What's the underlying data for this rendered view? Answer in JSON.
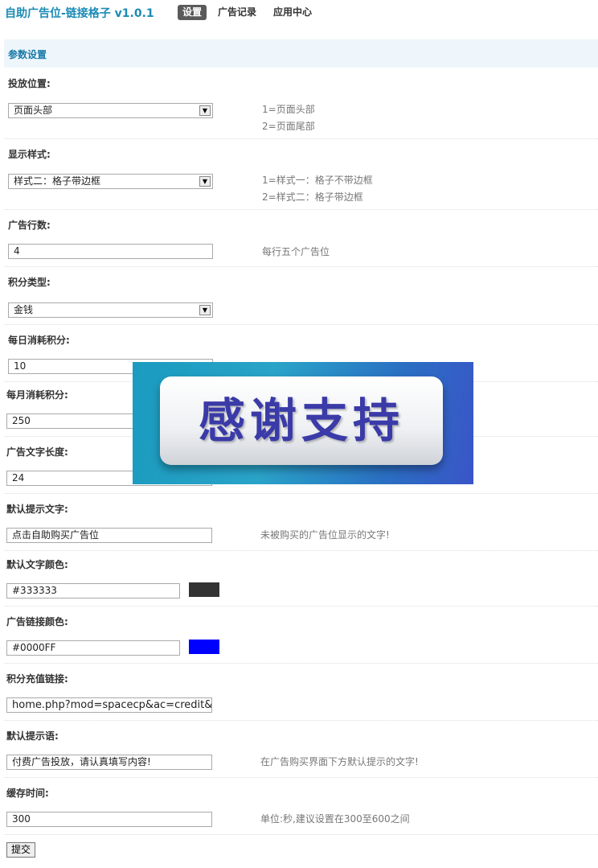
{
  "header": {
    "app_title": "自助广告位-链接格子 v1.0.1",
    "tabs": [
      {
        "label": "设置",
        "active": true
      },
      {
        "label": "广告记录",
        "active": false
      },
      {
        "label": "应用中心",
        "active": false
      }
    ]
  },
  "section": {
    "title": "参数设置"
  },
  "settings": {
    "position": {
      "label": "投放位置:",
      "value": "页面头部",
      "desc1": "1=页面头部",
      "desc2": "2=页面尾部"
    },
    "style": {
      "label": "显示样式:",
      "value": "样式二：格子带边框",
      "desc1": "1=样式一：格子不带边框",
      "desc2": "2=样式二：格子带边框"
    },
    "rows": {
      "label": "广告行数:",
      "value": "4",
      "desc": "每行五个广告位"
    },
    "credit_type": {
      "label": "积分类型:",
      "value": "金钱"
    },
    "daily_cost": {
      "label": "每日消耗积分:",
      "value": "10"
    },
    "monthly_cost": {
      "label": "每月消耗积分:",
      "value": "250"
    },
    "text_length": {
      "label": "广告文字长度:",
      "value": "24"
    },
    "default_text": {
      "label": "默认提示文字:",
      "value": "点击自助购买广告位",
      "desc": "未被购买的广告位显示的文字!"
    },
    "text_color": {
      "label": "默认文字颜色:",
      "value": "#333333",
      "swatch": "#333333"
    },
    "link_color": {
      "label": "广告链接颜色:",
      "value": "#0000FF",
      "swatch": "#0000FF"
    },
    "recharge_link": {
      "label": "积分充值链接:",
      "value": "home.php?mod=spacecp&ac=credit&op"
    },
    "default_tip": {
      "label": "默认提示语:",
      "value": "付费广告投放，请认真填写内容!",
      "desc": "在广告购买界面下方默认提示的文字!"
    },
    "cache_time": {
      "label": "缓存时间:",
      "value": "300",
      "desc": "单位:秒,建议设置在300至600之间"
    }
  },
  "submit_label": "提交",
  "overlay": {
    "text": "感谢支持"
  }
}
